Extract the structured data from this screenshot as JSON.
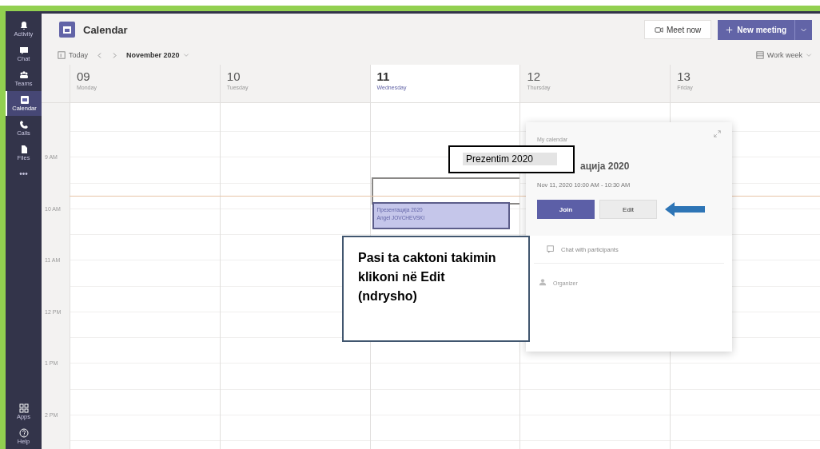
{
  "app_bar": {
    "items": [
      {
        "label": "Activity",
        "selected": false
      },
      {
        "label": "Chat",
        "selected": false
      },
      {
        "label": "Teams",
        "selected": false
      },
      {
        "label": "Calendar",
        "selected": true
      },
      {
        "label": "Calls",
        "selected": false
      },
      {
        "label": "Files",
        "selected": false
      },
      {
        "label": "•••",
        "selected": false
      }
    ],
    "bottom_items": [
      {
        "label": "Apps"
      },
      {
        "label": "Help"
      }
    ]
  },
  "header": {
    "title": "Calendar",
    "meet_now": "Meet now",
    "new_meeting": "New meeting"
  },
  "toolbar": {
    "today": "Today",
    "month": "November 2020",
    "view": "Work week"
  },
  "days": [
    {
      "number": "09",
      "weekday": "Monday",
      "selected": false
    },
    {
      "number": "10",
      "weekday": "Tuesday",
      "selected": false
    },
    {
      "number": "11",
      "weekday": "Wednesday",
      "selected": true
    },
    {
      "number": "12",
      "weekday": "Thursday",
      "selected": false
    },
    {
      "number": "13",
      "weekday": "Friday",
      "selected": false
    }
  ],
  "times": [
    "9 AM",
    "10 AM",
    "11 AM",
    "12 PM",
    "1 PM",
    "2 PM"
  ],
  "event": {
    "title": "Презентација 2020",
    "organizer": "Angel JOVCHEVSKI",
    "selected": true
  },
  "popup": {
    "calendar": "My calendar",
    "title": "ација 2020",
    "when": "Nov 11, 2020 10:00 AM - 10:30 AM",
    "join": "Join",
    "edit": "Edit",
    "chat": "Chat with participants",
    "organizer_role": "Organizer"
  },
  "annotations": [
    {
      "kind": "label",
      "text": "Prezentim 2020"
    },
    {
      "kind": "callout",
      "text": "Pasi ta caktoni takimin klikoni në Edit (ndrysho)"
    }
  ]
}
